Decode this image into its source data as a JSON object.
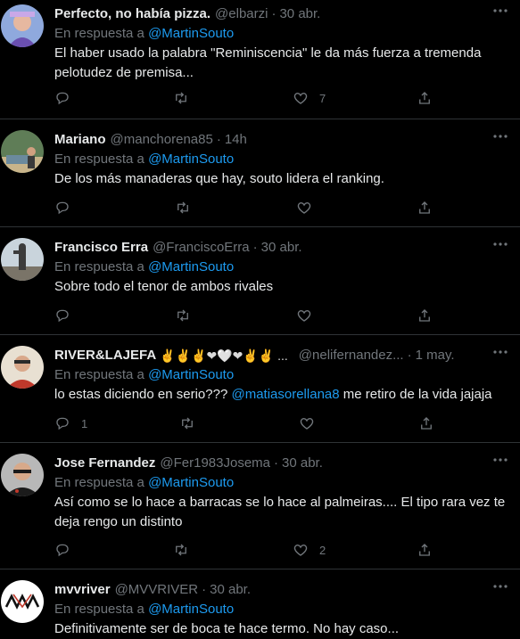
{
  "tweets": [
    {
      "name": "Perfecto, no había pizza.",
      "emojis": "",
      "handle": "@elbarzi",
      "time": "30 abr.",
      "reply_prefix": "En respuesta a",
      "reply_to": "@MartinSouto",
      "text": "El haber usado la palabra \"Reminiscencia\" le da más fuerza a tremenda pelotudez de premisa...",
      "text_parts": [],
      "mention_in_text": "",
      "replies": "",
      "retweets": "",
      "likes": "7"
    },
    {
      "name": "Mariano",
      "emojis": "",
      "handle": "@manchorena85",
      "time": "14h",
      "reply_prefix": "En respuesta a",
      "reply_to": "@MartinSouto",
      "text": "De los más manaderas que hay, souto lidera el ranking.",
      "replies": "",
      "retweets": "",
      "likes": ""
    },
    {
      "name": "Francisco Erra",
      "emojis": "",
      "handle": "@FranciscoErra",
      "time": "30 abr.",
      "reply_prefix": "En respuesta a",
      "reply_to": "@MartinSouto",
      "text": "Sobre todo el tenor de ambos rivales",
      "replies": "",
      "retweets": "",
      "likes": ""
    },
    {
      "name": "RIVER&LAJEFA",
      "emojis": "✌✌✌❤🤍❤✌✌ ...",
      "handle": "@nelifernandez...",
      "time": "1 may.",
      "reply_prefix": "En respuesta a",
      "reply_to": "@MartinSouto",
      "text_before": "lo estas diciendo en serio??? ",
      "text_mention": "@matiasorellana8",
      "text_after": " me retiro de la vida jajaja",
      "replies": "1",
      "retweets": "",
      "likes": ""
    },
    {
      "name": "Jose Fernandez",
      "emojis": "",
      "handle": "@Fer1983Josema",
      "time": "30 abr.",
      "reply_prefix": "En respuesta a",
      "reply_to": "@MartinSouto",
      "text": "Así como se lo hace a barracas se lo hace al palmeiras.... El tipo rara vez te deja rengo un distinto",
      "replies": "",
      "retweets": "",
      "likes": "2"
    },
    {
      "name": "mvvriver",
      "emojis": "",
      "handle": "@MVVRIVER",
      "time": "30 abr.",
      "reply_prefix": "En respuesta a",
      "reply_to": "@MartinSouto",
      "text": "Definitivamente ser de boca te hace termo. No hay caso...",
      "replies": "",
      "retweets": "",
      "likes": ""
    }
  ],
  "icons": {
    "reply": "reply-icon",
    "retweet": "retweet-icon",
    "like": "heart-icon",
    "share": "share-icon",
    "more": "more-icon"
  },
  "colors": {
    "background": "#000000",
    "text": "#e7e9ea",
    "muted": "#71767b",
    "link": "#1d9bf0",
    "divider": "#2f3336"
  }
}
